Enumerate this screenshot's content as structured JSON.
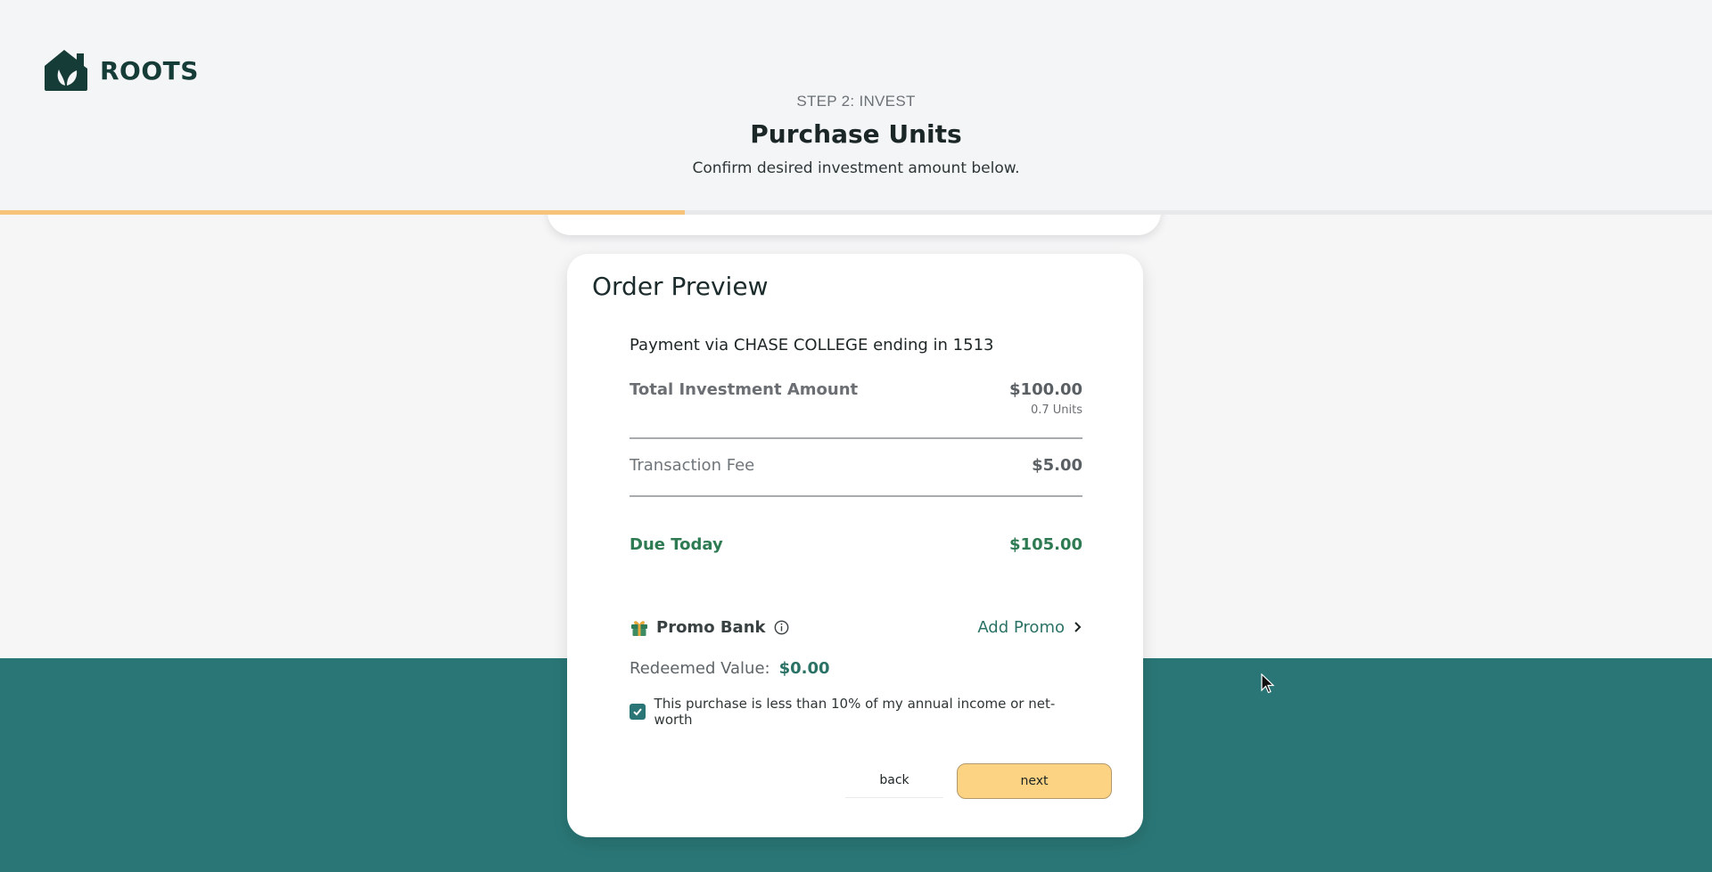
{
  "brand": {
    "name": "ROOTS",
    "logo_icon": "house-leaf-logo"
  },
  "step": {
    "label": "STEP 2: INVEST",
    "title": "Purchase Units",
    "subtitle": "Confirm desired investment amount below."
  },
  "progress": {
    "fraction": 0.4
  },
  "order_preview": {
    "title": "Order Preview",
    "payment_line": "Payment via CHASE COLLEGE ending in 1513",
    "total": {
      "label": "Total Investment Amount",
      "value": "$100.00",
      "units": "0.7 Units"
    },
    "fee": {
      "label": "Transaction Fee",
      "value": "$5.00"
    },
    "due": {
      "label": "Due Today",
      "value": "$105.00"
    },
    "promo": {
      "label": "Promo Bank",
      "icon": "gift-icon",
      "add_label": "Add Promo"
    },
    "redeemed": {
      "label": "Redeemed Value:",
      "value": "$0.00"
    },
    "checkbox": {
      "checked": true,
      "label": "This purchase is less than 10% of my annual income or net-worth"
    },
    "buttons": {
      "back": "back",
      "next": "next"
    }
  },
  "colors": {
    "teal": "#2a7676",
    "accent_yellow": "#fcd283",
    "green_text": "#2e7a53",
    "brand_dark": "#163c38"
  }
}
